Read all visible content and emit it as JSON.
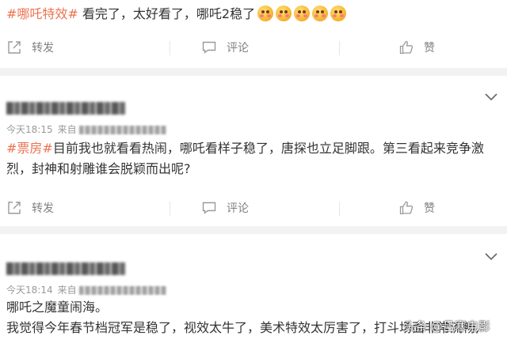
{
  "posts": [
    {
      "hashtag": "#哪吒特效#",
      "body": " 看完了，太好看了，哪吒2稳了",
      "emoji_count": 5,
      "emoji_icon": "blush-emoji-icon"
    },
    {
      "time": "今天18:15",
      "source_prefix": "来自",
      "hashtag": "#票房#",
      "body_line1": "目前我也就看看热闹，哪吒看样子稳了，唐探也立足脚跟。第三看起来竞争激",
      "body_line2": "烈，封神和射雕谁会脱颖而出呢?"
    },
    {
      "time": "今天18:14",
      "source_prefix": "来自",
      "line1": "哪吒之魔童闹海。",
      "line2": "我觉得今年春节档冠军是稳了，视效太牛了，美术特效太厉害了，打斗场面非常流畅,"
    }
  ],
  "actions": {
    "repost": "转发",
    "comment": "评论",
    "like": "赞"
  },
  "watermark": "头条 @吕寒电影",
  "colors": {
    "hashtag": "#eb7350",
    "text": "#333333",
    "meta": "#999999",
    "action": "#808080",
    "divider": "#f2f2f2"
  }
}
